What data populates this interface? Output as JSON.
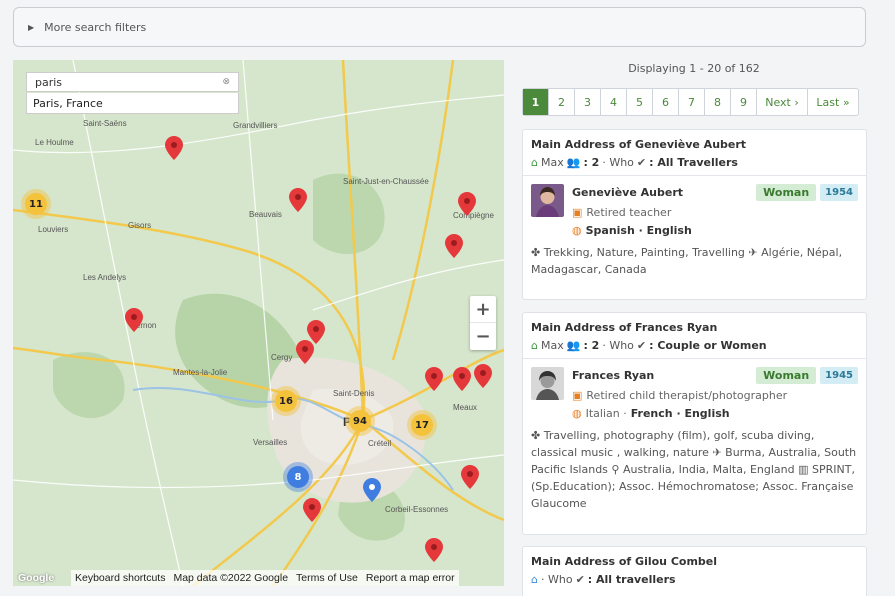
{
  "filters": {
    "label": "More search filters"
  },
  "map": {
    "search_value": "paris",
    "suggestion": "Paris, France",
    "clusters": [
      "11",
      "16",
      "94",
      "17",
      "8"
    ],
    "city_label": "Pa",
    "footer": {
      "logo": "Google",
      "shortcuts": "Keyboard shortcuts",
      "mapdata": "Map data ©2022 Google",
      "terms": "Terms of Use",
      "report": "Report a map error"
    }
  },
  "results": {
    "displaying": "Displaying 1 - 20 of 162",
    "pages": [
      "1",
      "2",
      "3",
      "4",
      "5",
      "6",
      "7",
      "8",
      "9"
    ],
    "next": "Next ›",
    "last": "Last »",
    "accent": "#4a8a3a"
  },
  "cards": [
    {
      "title": "Main Address of Geneviève Aubert",
      "max_label": "Max",
      "max_value": ": 2",
      "who_label": "· Who",
      "who_value": ": All Travellers",
      "name": "Geneviève Aubert",
      "gender": "Woman",
      "year": "1954",
      "job": "Retired teacher",
      "languages": "Spanish · English",
      "interests": "Trekking, Nature, Painting, Travelling",
      "destinations": "Algérie, Népal, Madagascar, Canada"
    },
    {
      "title": "Main Address of Frances Ryan",
      "max_label": "Max",
      "max_value": ": 2",
      "who_label": "· Who",
      "who_value": ": Couple or Women",
      "name": "Frances Ryan",
      "gender": "Woman",
      "year": "1945",
      "job": "Retired child therapist/photographer",
      "lang_light": "Italian ·",
      "languages": "French · English",
      "interests": "Travelling, photography (film), golf, scuba diving, classical music , walking, nature",
      "destinations": "Burma, Australia, South Pacific Islands",
      "places": "Australia, India, Malta, England",
      "orgs": "SPRINT, (Sp.Education); Assoc. Hémochromatose; Assoc. Française Glaucome"
    },
    {
      "title": "Main Address of Gilou Combel",
      "who_label": "· Who",
      "who_value": ": All travellers"
    }
  ]
}
